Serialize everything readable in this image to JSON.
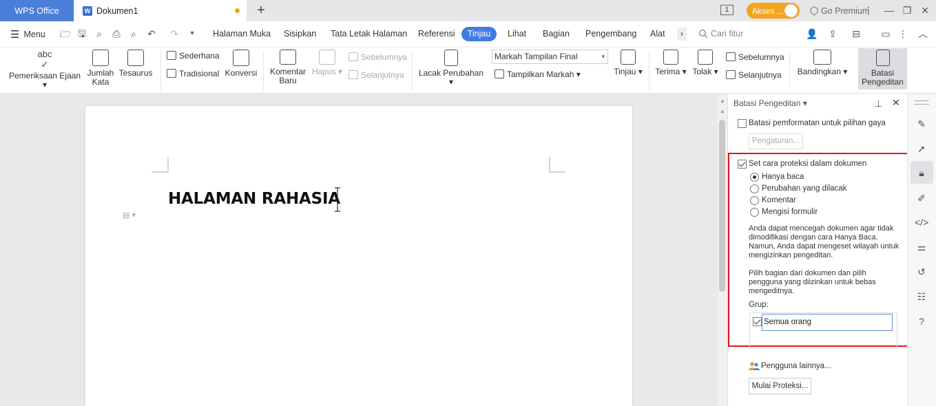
{
  "titlebar": {
    "app_tab": "WPS Office",
    "doc_tab": "Dokumen1",
    "page_indicator": "1",
    "akses_label": "Akses ...",
    "premium_label": "Go Premium"
  },
  "menubar": {
    "menu_label": "Menu",
    "tabs": [
      "Halaman Muka",
      "Sisipkan",
      "Tata Letak Halaman",
      "Referensi",
      "Tinjau",
      "Lihat",
      "Bagian",
      "Pengembang",
      "Alat"
    ],
    "active_tab": "Tinjau",
    "search_placeholder": "Cari fitur"
  },
  "ribbon": {
    "pemeriksaan": "Pemeriksaan Ejaan",
    "abc": "abc",
    "jumlah_kata": [
      "Jumlah",
      "Kata"
    ],
    "tesaurus": "Tesaurus",
    "sederhana": "Sederhana",
    "tradisional": "Tradisional",
    "konversi": "Konversi",
    "komentar_baru": [
      "Komentar",
      "Baru"
    ],
    "hapus": "Hapus",
    "sebelumnya_c": "Sebelumnya",
    "selanjutnya_c": "Selanjutnya",
    "lacak": "Lacak Perubahan",
    "markah_select": "Markah Tampilan Final",
    "tampilkan_markah": "Tampilkan Markah",
    "tinjau": "Tinjau",
    "terima": "Terima",
    "tolak": "Tolak",
    "sebelumnya_r": "Sebelumnya",
    "selanjutnya_r": "Selanjutnya",
    "bandingkan": "Bandingkan",
    "batasi": [
      "Batasi",
      "Pengeditan"
    ]
  },
  "document": {
    "heading": "HALAMAN RAHASIA"
  },
  "panel": {
    "title": "Batasi Pengeditan",
    "format_limit_label": "Batasi pemformatan untuk pilihan gaya",
    "format_limit_checked": false,
    "pengaturan_button": "Pengaturan...",
    "protect_label": "Set cara proteksi dalam dokumen",
    "protect_checked": true,
    "options": [
      "Hanya baca",
      "Perubahan yang dilacak",
      "Komentar",
      "Mengisi formulir"
    ],
    "selected_option": "Hanya baca",
    "desc1": "Anda dapat mencegah dokumen agar tidak dimodifikasi dengan cara Hanya Baca. Namun, Anda dapat mengeset wilayah untuk mengizinkan pengeditan.",
    "desc2": "Pilih bagian dari dokumen dan pilih pengguna yang diizinkan untuk bebas mengeditnya.",
    "grup_label": "Grup:",
    "grup_item": "Semua orang",
    "grup_item_checked": true,
    "pengguna_link": "Pengguna lainnya...",
    "mulai_button": "Mulai Proteksi..."
  },
  "colors": {
    "accent": "#3e7be4",
    "wps_tab": "#4a7ed9",
    "akses": "#f2a51e",
    "highlight_border": "#e0141b"
  }
}
